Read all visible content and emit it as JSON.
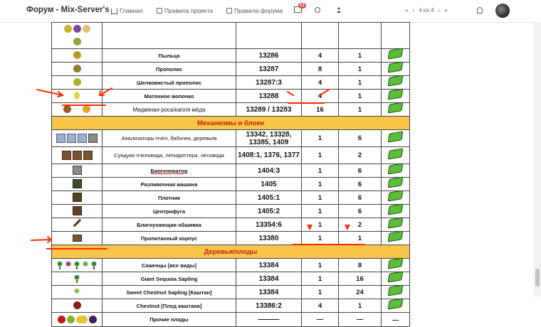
{
  "header": {
    "forum_title": "Форум - Mix-Server's",
    "nav": [
      {
        "label": "Главная",
        "icon": "home-icon"
      },
      {
        "label": "Правила проекта",
        "icon": "book-icon"
      },
      {
        "label": "Правила форума",
        "icon": "book-icon"
      }
    ],
    "notifications_count": "13",
    "pager_label": "4 из 4"
  },
  "table": {
    "rows": [
      {
        "name": "",
        "id": "",
        "qty": "",
        "price": ""
      },
      {
        "name": "Пыльца",
        "id": "13286",
        "qty": "4",
        "price": "1"
      },
      {
        "name": "Прополис",
        "id": "13287",
        "qty": "8",
        "price": "1"
      },
      {
        "name": "Шелковистый прополис",
        "id": "13287:3",
        "qty": "4",
        "price": "1"
      },
      {
        "name": "Маточное молочко",
        "id": "13288",
        "qty": "4",
        "price": "1"
      },
      {
        "name": "Медвяная роса/капля мёда",
        "id": "13289 / 13283",
        "qty": "16",
        "price": "1"
      }
    ],
    "section1": "Механизмы и блоки",
    "rows2": [
      {
        "name": "Анализаторы пчёл, бабочек, деревьев",
        "id": "13342, 13328, 13385, 1409",
        "qty": "1",
        "price": "6"
      },
      {
        "name": "Сундуки пчеловода, лепидоптера, лесовода",
        "id": "1408:1, 1376, 1377",
        "qty": "1",
        "price": "2"
      },
      {
        "name": "Биогенератор",
        "id": "1404:3",
        "qty": "1",
        "price": "6"
      },
      {
        "name": "Разливочная машина",
        "id": "1405",
        "qty": "1",
        "price": "6"
      },
      {
        "name": "Плотник",
        "id": "1405:1",
        "qty": "1",
        "price": "6"
      },
      {
        "name": "Центрифуга",
        "id": "1405:2",
        "qty": "1",
        "price": "6"
      },
      {
        "name": "Благоухающая обшивка",
        "id": "13354:6",
        "qty": "1",
        "price": "2"
      },
      {
        "name": "Пропитанный корпус",
        "id": "13380",
        "qty": "1",
        "price": "1"
      }
    ],
    "section2": "Деревья/плоды",
    "rows3": [
      {
        "name": "Саженцы [все виды]",
        "id": "13384",
        "qty": "1",
        "price": "8"
      },
      {
        "name": "Giant Sequoia Sapling",
        "id": "13384",
        "qty": "1",
        "price": "16"
      },
      {
        "name": "Sweet Chestnut Sapling [Каштан]",
        "id": "13384",
        "qty": "1",
        "price": "24"
      },
      {
        "name": "Chestnut [Плод каштана]",
        "id": "13386:2",
        "qty": "4",
        "price": "1"
      },
      {
        "name": "Прочие плоды",
        "id": "———",
        "qty": "—",
        "price": "—"
      }
    ]
  },
  "colors": {
    "red": "#e31818",
    "section_bg": "#f7c54a",
    "annotation": "#ff2a00"
  }
}
